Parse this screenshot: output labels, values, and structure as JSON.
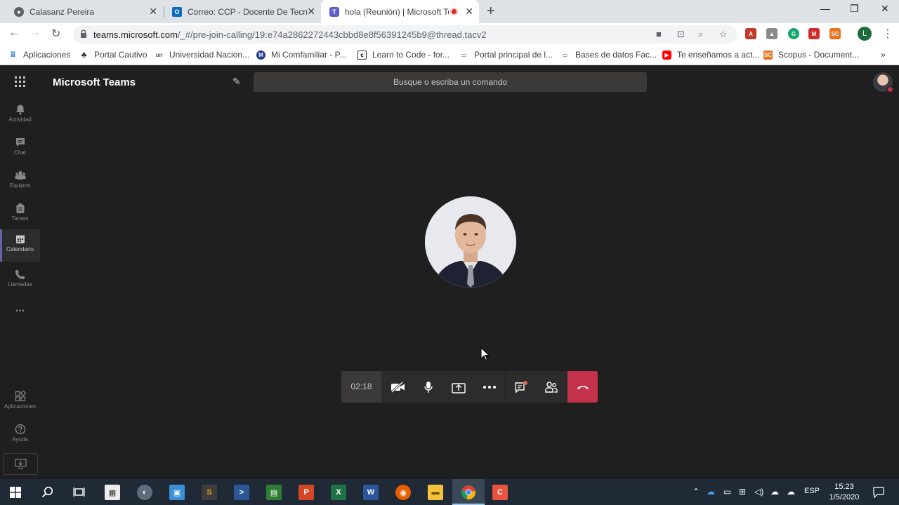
{
  "browser": {
    "tabs": [
      {
        "title": "Calasanz Pereira",
        "favicon": "chrome-profile-icon"
      },
      {
        "title": "Correo: CCP - Docente De Tecnol",
        "favicon": "outlook-icon"
      },
      {
        "title": "hola (Reunión) | Microsoft Te",
        "favicon": "teams-icon",
        "active": true
      }
    ],
    "address": {
      "host": "teams.microsoft.com",
      "path": "/_#/pre-join-calling/19:e74a2862272443cbbd8e8f56391245b9@thread.tacv2"
    },
    "profile_initial": "L",
    "bookmarks": [
      "Aplicaciones",
      "Portal Cautivo",
      "Universidad Nacion...",
      "Mi Comfamiliar - P...",
      "Learn to Code - for...",
      "Portal principal de l...",
      "Bases de datos Fac...",
      "Te enseñamos a act...",
      "Scopus - Document..."
    ],
    "bookmarks_more": "»"
  },
  "teams": {
    "app_title": "Microsoft Teams",
    "search_placeholder": "Busque o escriba un comando",
    "rail": [
      {
        "label": "Actividad",
        "icon": "bell-icon"
      },
      {
        "label": "Chat",
        "icon": "chat-icon"
      },
      {
        "label": "Equipos",
        "icon": "teams-icon"
      },
      {
        "label": "Tareas",
        "icon": "assignments-icon"
      },
      {
        "label": "Calendario",
        "icon": "calendar-icon",
        "active": true
      },
      {
        "label": "Llamadas",
        "icon": "phone-icon"
      }
    ],
    "rail_more": "...",
    "rail_bottom": [
      {
        "label": "Aplicaciones",
        "icon": "apps-icon"
      },
      {
        "label": "Ayuda",
        "icon": "help-icon"
      }
    ],
    "call": {
      "timer": "02:18",
      "buttons": [
        "camera-off-icon",
        "microphone-icon",
        "share-screen-icon",
        "more-options-icon",
        "chat-conversation-icon",
        "participants-icon"
      ],
      "hangup_icon": "hang-up-icon"
    }
  },
  "taskbar": {
    "language": "ESP",
    "time": "15:23",
    "date": "1/5/2020"
  },
  "colors": {
    "teams_bg": "#201f1f",
    "teams_accent": "#6264a7",
    "hangup": "#c4314b",
    "taskbar": "#1f2a36"
  }
}
